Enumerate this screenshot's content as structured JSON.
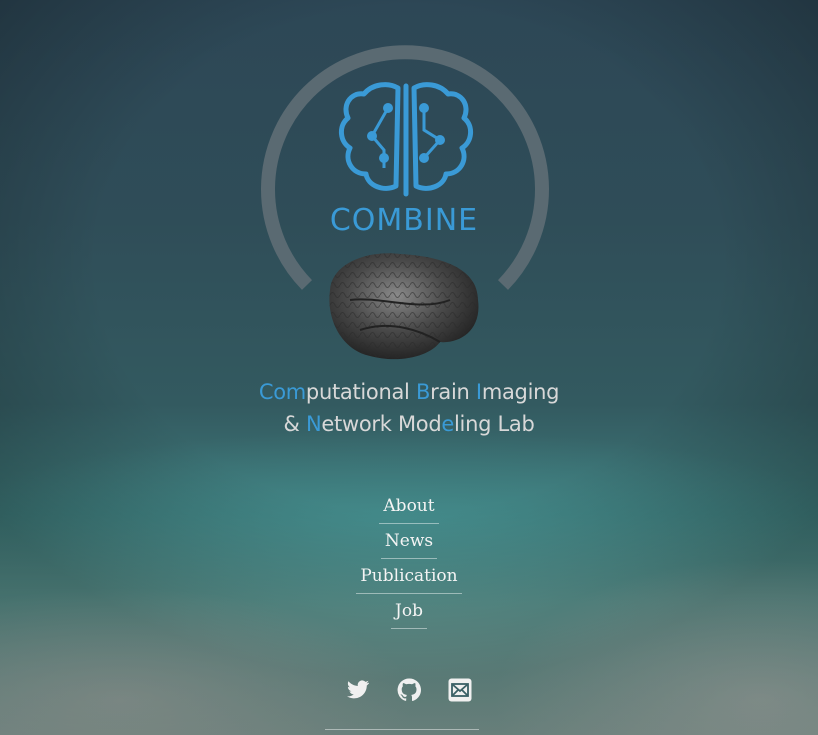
{
  "logo": {
    "brand_text": "COMBINE",
    "brand_color": "#3a9ad6",
    "ring_color": "#5a6a72"
  },
  "subtitle": {
    "line1": [
      {
        "t": "C",
        "cap": true
      },
      {
        "t": "om",
        "cap": true
      },
      {
        "t": "putational ",
        "cap": false
      },
      {
        "t": "B",
        "cap": true
      },
      {
        "t": "rain ",
        "cap": false
      },
      {
        "t": "I",
        "cap": true
      },
      {
        "t": "maging",
        "cap": false
      }
    ],
    "line2": [
      {
        "t": "& ",
        "cap": false
      },
      {
        "t": "N",
        "cap": true
      },
      {
        "t": "etwork ",
        "cap": false
      },
      {
        "t": "M",
        "cap": false
      },
      {
        "t": "od",
        "cap": false
      },
      {
        "t": "e",
        "cap": true
      },
      {
        "t": "ling Lab",
        "cap": false
      }
    ]
  },
  "nav": {
    "about": "About",
    "news": "News",
    "publication": "Publication",
    "job": "Job"
  },
  "social": {
    "twitter": "twitter-icon",
    "github": "github-icon",
    "email": "email-icon"
  }
}
